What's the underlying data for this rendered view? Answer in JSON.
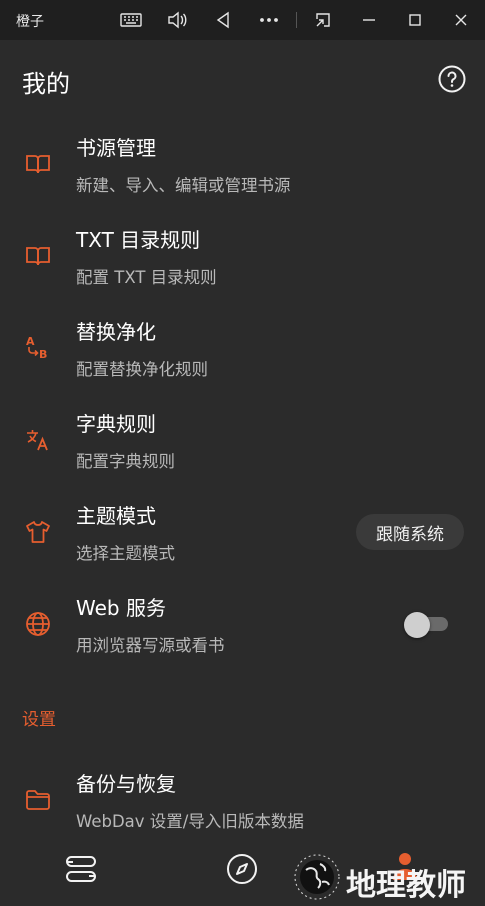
{
  "window": {
    "title": "橙子"
  },
  "appbar": {
    "title": "我的"
  },
  "items": [
    {
      "title": "书源管理",
      "subtitle": "新建、导入、编辑或管理书源"
    },
    {
      "title": "TXT 目录规则",
      "subtitle": "配置 TXT 目录规则"
    },
    {
      "title": "替换净化",
      "subtitle": "配置替换净化规则"
    },
    {
      "title": "字典规则",
      "subtitle": "配置字典规则"
    },
    {
      "title": "主题模式",
      "subtitle": "选择主题模式"
    },
    {
      "title": "Web 服务",
      "subtitle": "用浏览器写源或看书"
    },
    {
      "title": "备份与恢复",
      "subtitle": "WebDav 设置/导入旧版本数据"
    }
  ],
  "theme_mode_value": "跟随系统",
  "web_service_enabled": false,
  "section_settings": "设置",
  "watermark": {
    "text": "地理教师"
  },
  "icons": {
    "book_source": "book-open-icon",
    "txt_rules": "book-open-icon",
    "replace": "replace-ab-icon",
    "dict": "translate-icon",
    "theme": "tshirt-icon",
    "web": "globe-icon",
    "backup": "folder-icon"
  },
  "colors": {
    "accent": "#e65e2f",
    "background": "#2b2b2b",
    "titlebar": "#1f1f1f"
  }
}
